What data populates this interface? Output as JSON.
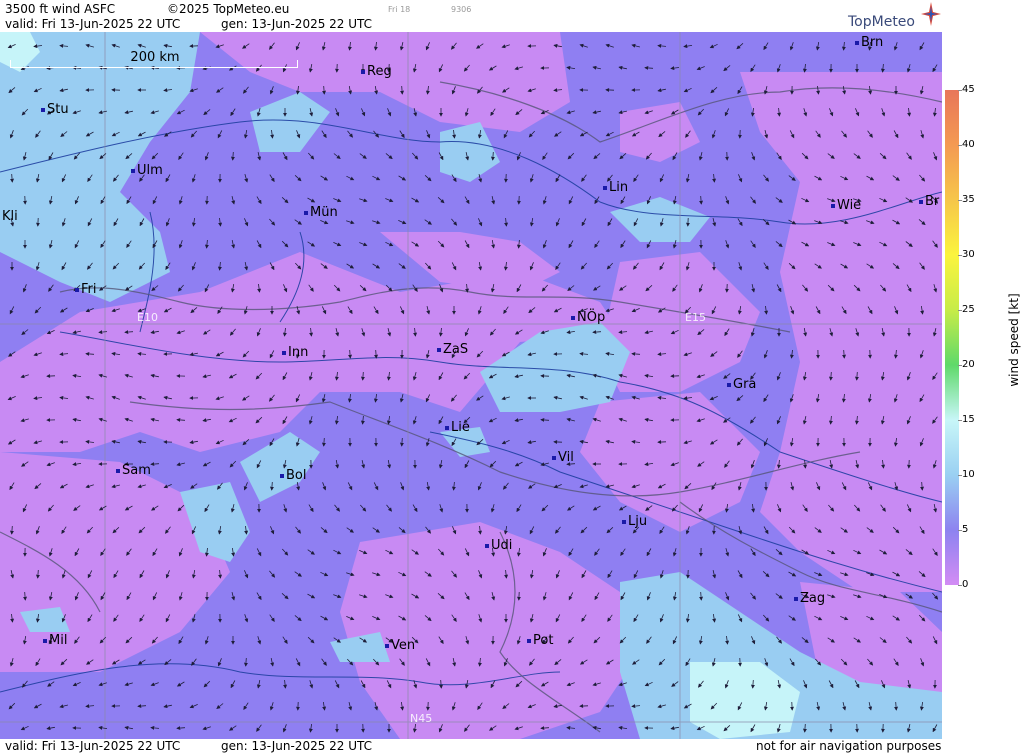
{
  "header": {
    "product": "3500 ft wind ASFC",
    "copyright": "©2025 TopMeteo.eu",
    "valid": "valid:  Fri  13-Jun-2025  22 UTC",
    "gen": "gen: 13-Jun-2025  22 UTC",
    "faint_day": "Fri 18",
    "faint_code": "9306"
  },
  "logo": {
    "text": "TopMeteo",
    "icon": "compass-star-icon"
  },
  "map": {
    "scale_label": "200 km",
    "grid_labels": {
      "e10": "E10",
      "e15": "E15",
      "n45": "N45"
    },
    "cities": [
      {
        "name": "Stu"
      },
      {
        "name": "Ulm"
      },
      {
        "name": "Reg"
      },
      {
        "name": "Brn"
      },
      {
        "name": "Kli"
      },
      {
        "name": "Mün"
      },
      {
        "name": "Lin"
      },
      {
        "name": "Wie"
      },
      {
        "name": "Br"
      },
      {
        "name": "Fri"
      },
      {
        "name": "Inn"
      },
      {
        "name": "ZaS"
      },
      {
        "name": "NÖp"
      },
      {
        "name": "Gra"
      },
      {
        "name": "Lie"
      },
      {
        "name": "Vil"
      },
      {
        "name": "Sam"
      },
      {
        "name": "Bol"
      },
      {
        "name": "Lju"
      },
      {
        "name": "Udi"
      },
      {
        "name": "Zag"
      },
      {
        "name": "Mil"
      },
      {
        "name": "Ven"
      },
      {
        "name": "Pot"
      }
    ],
    "wind_arrows": "wind-arrow-icon"
  },
  "legend": {
    "unit": "wind speed  [kt]",
    "ticks": [
      "45",
      "40",
      "35",
      "30",
      "25",
      "20",
      "15",
      "10",
      "5",
      "0"
    ],
    "colors": [
      "#e8765a",
      "#f49a52",
      "#f6c64a",
      "#fbf43e",
      "#c7ec48",
      "#5fd96a",
      "#c8f6f8",
      "#9ad0f2",
      "#8d83f0",
      "#d38cf4"
    ]
  },
  "footer": {
    "valid": "valid:  Fri  13-Jun-2025  22 UTC",
    "gen": "gen: 13-Jun-2025  22 UTC",
    "note": "not for air navigation purposes"
  }
}
